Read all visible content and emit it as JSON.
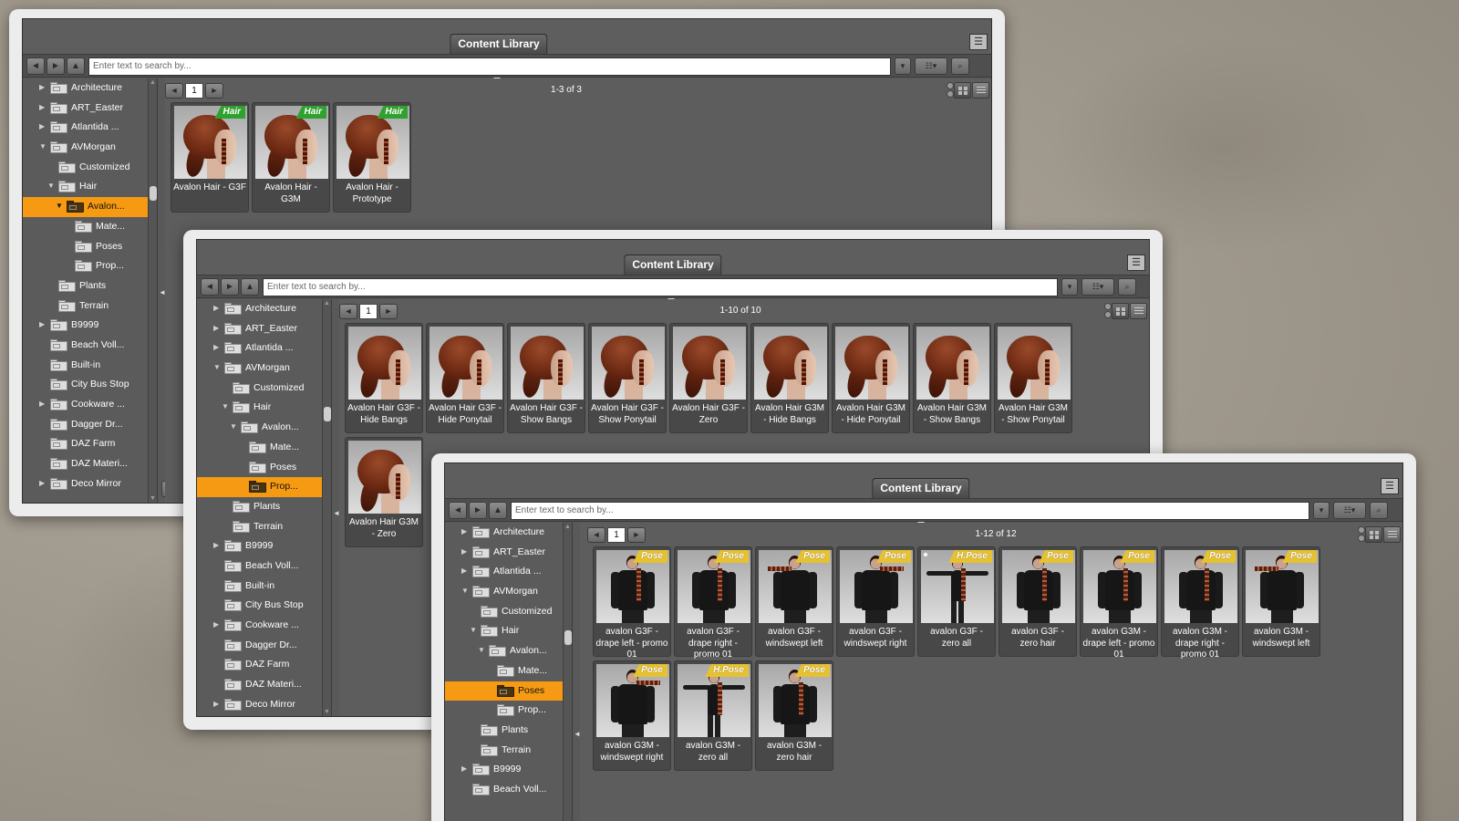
{
  "windows": [
    {
      "title": "Content Library",
      "search_placeholder": "Enter text to search by...",
      "page": "1",
      "count": "1-3 of 3",
      "tree": [
        {
          "label": "Architecture",
          "indent": 0,
          "arrow": "right"
        },
        {
          "label": "ART_Easter",
          "indent": 0,
          "arrow": "right"
        },
        {
          "label": "Atlantida ...",
          "indent": 0,
          "arrow": "right"
        },
        {
          "label": "AVMorgan",
          "indent": 0,
          "arrow": "down"
        },
        {
          "label": "Customized",
          "indent": 1,
          "arrow": ""
        },
        {
          "label": "Hair",
          "indent": 1,
          "arrow": "down"
        },
        {
          "label": "Avalon...",
          "indent": 2,
          "arrow": "down",
          "selected": true
        },
        {
          "label": "Mate...",
          "indent": 3,
          "arrow": ""
        },
        {
          "label": "Poses",
          "indent": 3,
          "arrow": ""
        },
        {
          "label": "Prop...",
          "indent": 3,
          "arrow": ""
        },
        {
          "label": "Plants",
          "indent": 1,
          "arrow": ""
        },
        {
          "label": "Terrain",
          "indent": 1,
          "arrow": ""
        },
        {
          "label": "B9999",
          "indent": 0,
          "arrow": "right"
        },
        {
          "label": "Beach Voll...",
          "indent": 0,
          "arrow": ""
        },
        {
          "label": "Built-in",
          "indent": 0,
          "arrow": ""
        },
        {
          "label": "City Bus Stop",
          "indent": 0,
          "arrow": ""
        },
        {
          "label": "Cookware ...",
          "indent": 0,
          "arrow": "right"
        },
        {
          "label": "Dagger Dr...",
          "indent": 0,
          "arrow": ""
        },
        {
          "label": "DAZ Farm",
          "indent": 0,
          "arrow": ""
        },
        {
          "label": "DAZ Materi...",
          "indent": 0,
          "arrow": ""
        },
        {
          "label": "Deco Mirror",
          "indent": 0,
          "arrow": "right"
        }
      ],
      "items": [
        {
          "label": "Avalon Hair - G3F",
          "badge": "Hair",
          "kind": "hair"
        },
        {
          "label": "Avalon Hair - G3M",
          "badge": "Hair",
          "kind": "hair"
        },
        {
          "label": "Avalon Hair - Prototype",
          "badge": "Hair",
          "kind": "hair"
        }
      ]
    },
    {
      "title": "Content Library",
      "search_placeholder": "Enter text to search by...",
      "page": "1",
      "count": "1-10 of 10",
      "tree": [
        {
          "label": "Architecture",
          "indent": 0,
          "arrow": "right"
        },
        {
          "label": "ART_Easter",
          "indent": 0,
          "arrow": "right"
        },
        {
          "label": "Atlantida ...",
          "indent": 0,
          "arrow": "right"
        },
        {
          "label": "AVMorgan",
          "indent": 0,
          "arrow": "down"
        },
        {
          "label": "Customized",
          "indent": 1,
          "arrow": ""
        },
        {
          "label": "Hair",
          "indent": 1,
          "arrow": "down"
        },
        {
          "label": "Avalon...",
          "indent": 2,
          "arrow": "down"
        },
        {
          "label": "Mate...",
          "indent": 3,
          "arrow": ""
        },
        {
          "label": "Poses",
          "indent": 3,
          "arrow": ""
        },
        {
          "label": "Prop...",
          "indent": 3,
          "arrow": "",
          "selected": true
        },
        {
          "label": "Plants",
          "indent": 1,
          "arrow": ""
        },
        {
          "label": "Terrain",
          "indent": 1,
          "arrow": ""
        },
        {
          "label": "B9999",
          "indent": 0,
          "arrow": "right"
        },
        {
          "label": "Beach Voll...",
          "indent": 0,
          "arrow": ""
        },
        {
          "label": "Built-in",
          "indent": 0,
          "arrow": ""
        },
        {
          "label": "City Bus Stop",
          "indent": 0,
          "arrow": ""
        },
        {
          "label": "Cookware ...",
          "indent": 0,
          "arrow": "right"
        },
        {
          "label": "Dagger Dr...",
          "indent": 0,
          "arrow": ""
        },
        {
          "label": "DAZ Farm",
          "indent": 0,
          "arrow": ""
        },
        {
          "label": "DAZ Materi...",
          "indent": 0,
          "arrow": ""
        },
        {
          "label": "Deco Mirror",
          "indent": 0,
          "arrow": "right"
        }
      ],
      "items": [
        {
          "label": "Avalon Hair G3F - Hide Bangs",
          "kind": "hair"
        },
        {
          "label": "Avalon Hair G3F - Hide Ponytail",
          "kind": "hair"
        },
        {
          "label": "Avalon Hair G3F - Show Bangs",
          "kind": "hair"
        },
        {
          "label": "Avalon Hair G3F - Show Ponytail",
          "kind": "hair"
        },
        {
          "label": "Avalon Hair G3F - Zero",
          "kind": "hair"
        },
        {
          "label": "Avalon Hair G3M - Hide Bangs",
          "kind": "hair"
        },
        {
          "label": "Avalon Hair G3M - Hide Ponytail",
          "kind": "hair"
        },
        {
          "label": "Avalon Hair G3M - Show Bangs",
          "kind": "hair"
        },
        {
          "label": "Avalon Hair G3M - Show Ponytail",
          "kind": "hair"
        },
        {
          "label": "Avalon Hair G3M - Zero",
          "kind": "hair"
        }
      ]
    },
    {
      "title": "Content Library",
      "search_placeholder": "Enter text to search by...",
      "page": "1",
      "count": "1-12 of 12",
      "tree": [
        {
          "label": "Architecture",
          "indent": 0,
          "arrow": "right"
        },
        {
          "label": "ART_Easter",
          "indent": 0,
          "arrow": "right"
        },
        {
          "label": "Atlantida ...",
          "indent": 0,
          "arrow": "right"
        },
        {
          "label": "AVMorgan",
          "indent": 0,
          "arrow": "down"
        },
        {
          "label": "Customized",
          "indent": 1,
          "arrow": ""
        },
        {
          "label": "Hair",
          "indent": 1,
          "arrow": "down"
        },
        {
          "label": "Avalon...",
          "indent": 2,
          "arrow": "down"
        },
        {
          "label": "Mate...",
          "indent": 3,
          "arrow": ""
        },
        {
          "label": "Poses",
          "indent": 3,
          "arrow": "",
          "selected": true
        },
        {
          "label": "Prop...",
          "indent": 3,
          "arrow": ""
        },
        {
          "label": "Plants",
          "indent": 1,
          "arrow": ""
        },
        {
          "label": "Terrain",
          "indent": 1,
          "arrow": ""
        },
        {
          "label": "B9999",
          "indent": 0,
          "arrow": "right"
        },
        {
          "label": "Beach Voll...",
          "indent": 0,
          "arrow": ""
        }
      ],
      "items": [
        {
          "label": "avalon G3F - drape left - promo 01",
          "badge": "Pose",
          "kind": "pose"
        },
        {
          "label": "avalon G3F - drape right - promo 01",
          "badge": "Pose",
          "kind": "pose"
        },
        {
          "label": "avalon G3F - windswept left",
          "badge": "Pose",
          "kind": "wind-left"
        },
        {
          "label": "avalon G3F - windswept right",
          "badge": "Pose",
          "kind": "wind-right"
        },
        {
          "label": "avalon G3F - zero all",
          "badge": "H.Pose",
          "kind": "tpose",
          "dot": true
        },
        {
          "label": "avalon G3F - zero hair",
          "badge": "Pose",
          "kind": "pose"
        },
        {
          "label": "avalon G3M - drape left - promo 01",
          "badge": "Pose",
          "kind": "pose"
        },
        {
          "label": "avalon G3M - drape right - promo 01",
          "badge": "Pose",
          "kind": "pose"
        },
        {
          "label": "avalon G3M - windswept left",
          "badge": "Pose",
          "kind": "wind-left"
        },
        {
          "label": "avalon G3M - windswept right",
          "badge": "Pose",
          "kind": "wind-right"
        },
        {
          "label": "avalon G3M - zero all",
          "badge": "H.Pose",
          "kind": "tpose"
        },
        {
          "label": "avalon G3M - zero hair",
          "badge": "Pose",
          "kind": "pose"
        }
      ]
    }
  ],
  "icons": {
    "back": "◄",
    "forward": "►",
    "up": "▲",
    "search": "⌕",
    "menu": "☰",
    "close": "✕",
    "add": "+",
    "remove": "−"
  }
}
